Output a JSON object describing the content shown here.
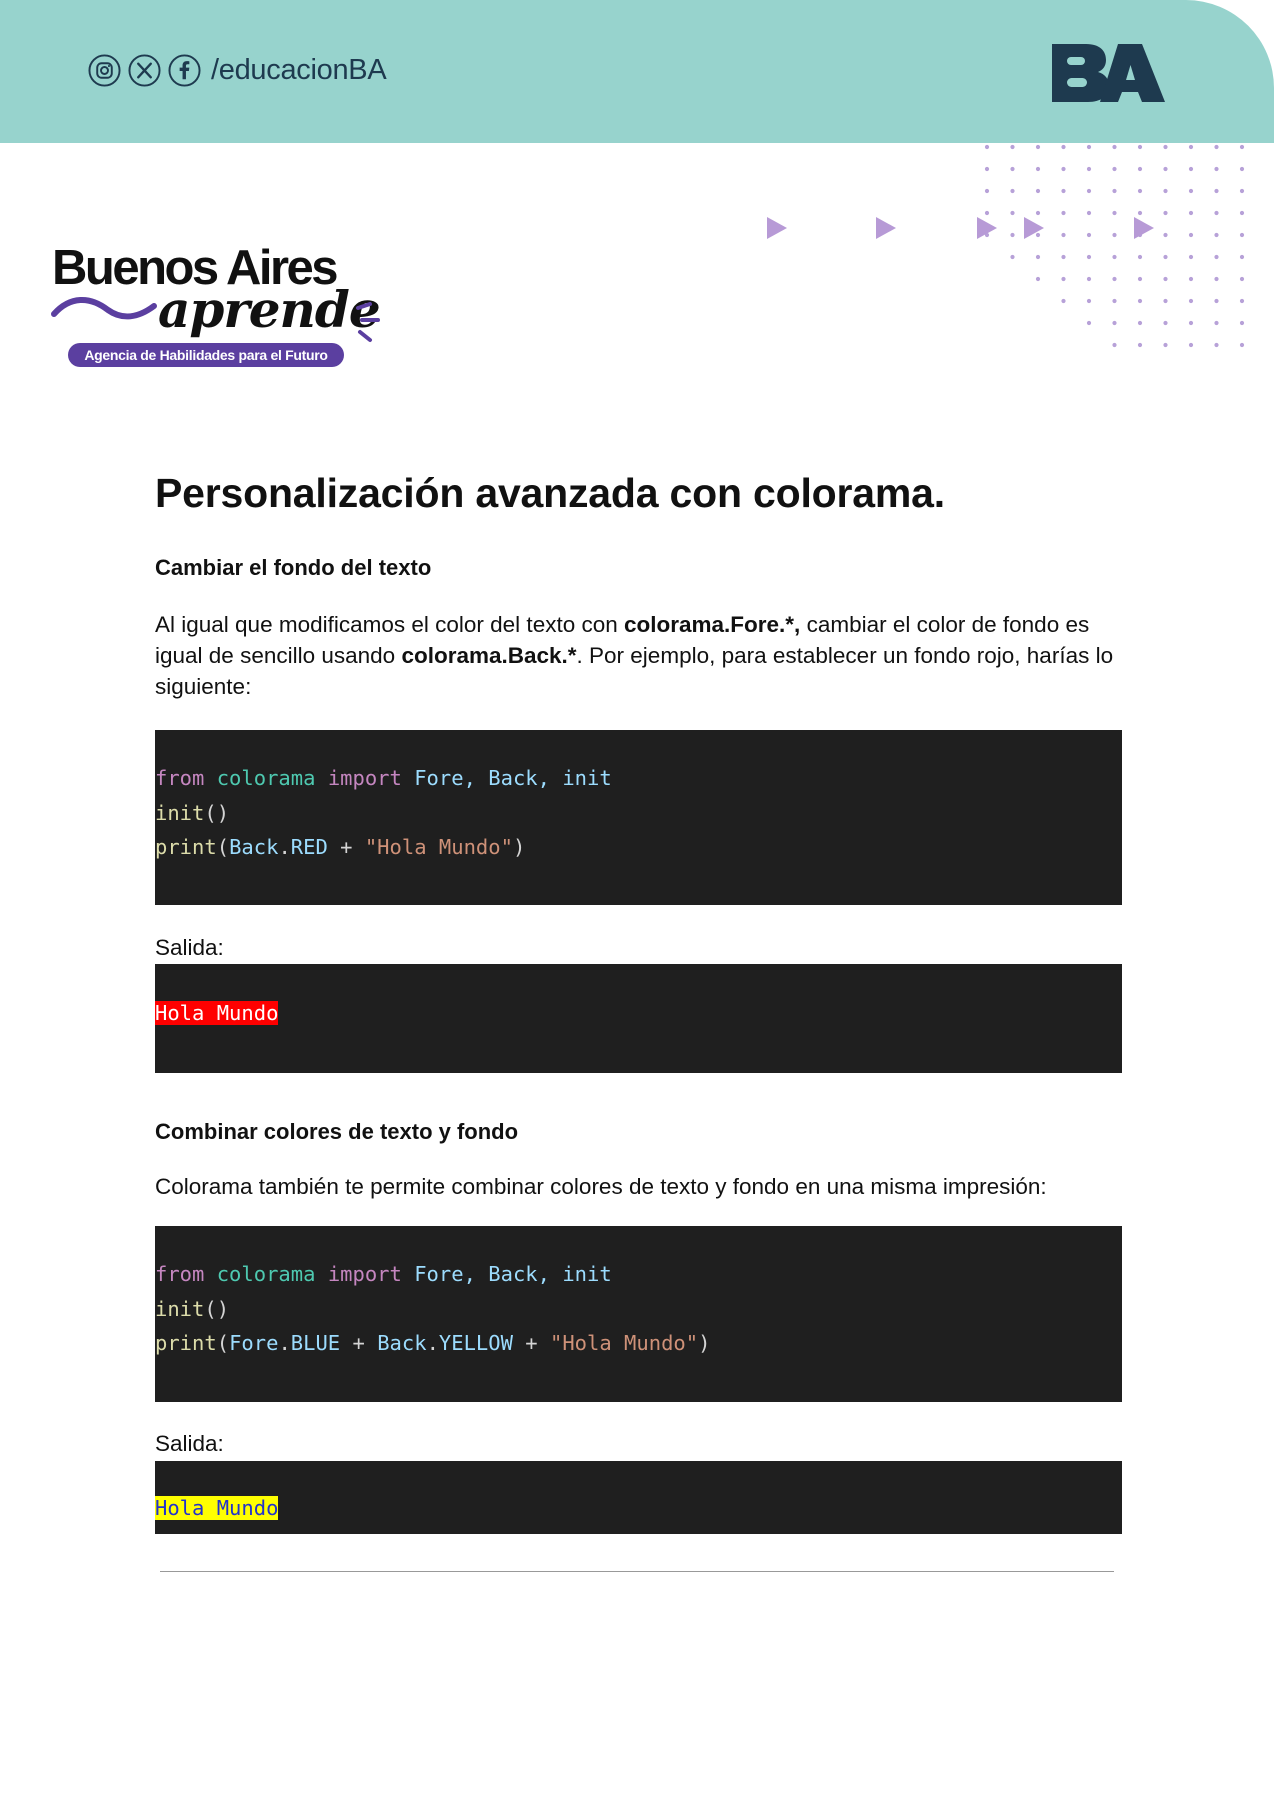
{
  "header": {
    "social_handle": "/educacionBA",
    "social_icons": [
      "instagram-icon",
      "x-icon",
      "facebook-icon"
    ],
    "brand_logo": "BA",
    "background_color": "#97d3cd"
  },
  "logo": {
    "title": "Buenos Aires",
    "script": "aprende",
    "tagline": "Agencia de Habilidades para el Futuro",
    "accent_color": "#5b3fa0"
  },
  "article": {
    "title": "Personalización avanzada con colorama.",
    "section1": {
      "heading": "Cambiar el fondo del texto",
      "p_part1": "Al igual que modificamos el color del texto con ",
      "p_bold1": "colorama.Fore.*,",
      "p_part2": " cambiar el color de fondo es igual de sencillo usando ",
      "p_bold2": "colorama.Back.*",
      "p_part3": ". Por ejemplo, para establecer un fondo rojo, harías lo siguiente:",
      "code": {
        "line1": {
          "kw1": "from",
          "mod": "colorama",
          "kw2": "import",
          "names": "Fore, Back, init"
        },
        "line2": {
          "fn": "init",
          "punc": "()"
        },
        "line3": {
          "fn": "print",
          "open": "(",
          "obj": "Back",
          "dot": ".",
          "attr": "RED",
          "plus": " + ",
          "str": "\"Hola Mundo\"",
          "close": ")"
        }
      },
      "output_label": "Salida:",
      "output_text": "Hola Mundo",
      "output_bg": "#ff0000"
    },
    "section2": {
      "heading": "Combinar colores de texto y fondo",
      "paragraph": "Colorama también te permite combinar colores de texto y fondo en una misma impresión:",
      "code": {
        "line1": {
          "kw1": "from",
          "mod": "colorama",
          "kw2": "import",
          "names": "Fore, Back, init"
        },
        "line2": {
          "fn": "init",
          "punc": "()"
        },
        "line3": {
          "fn": "print",
          "open": "(",
          "obj1": "Fore",
          "attr1": "BLUE",
          "plus1": " + ",
          "obj2": "Back",
          "attr2": "YELLOW",
          "plus2": " + ",
          "str": "\"Hola Mundo\"",
          "close": ")"
        }
      },
      "output_label": "Salida:",
      "output_text": "Hola Mundo",
      "output_bg": "#ffff00"
    }
  }
}
